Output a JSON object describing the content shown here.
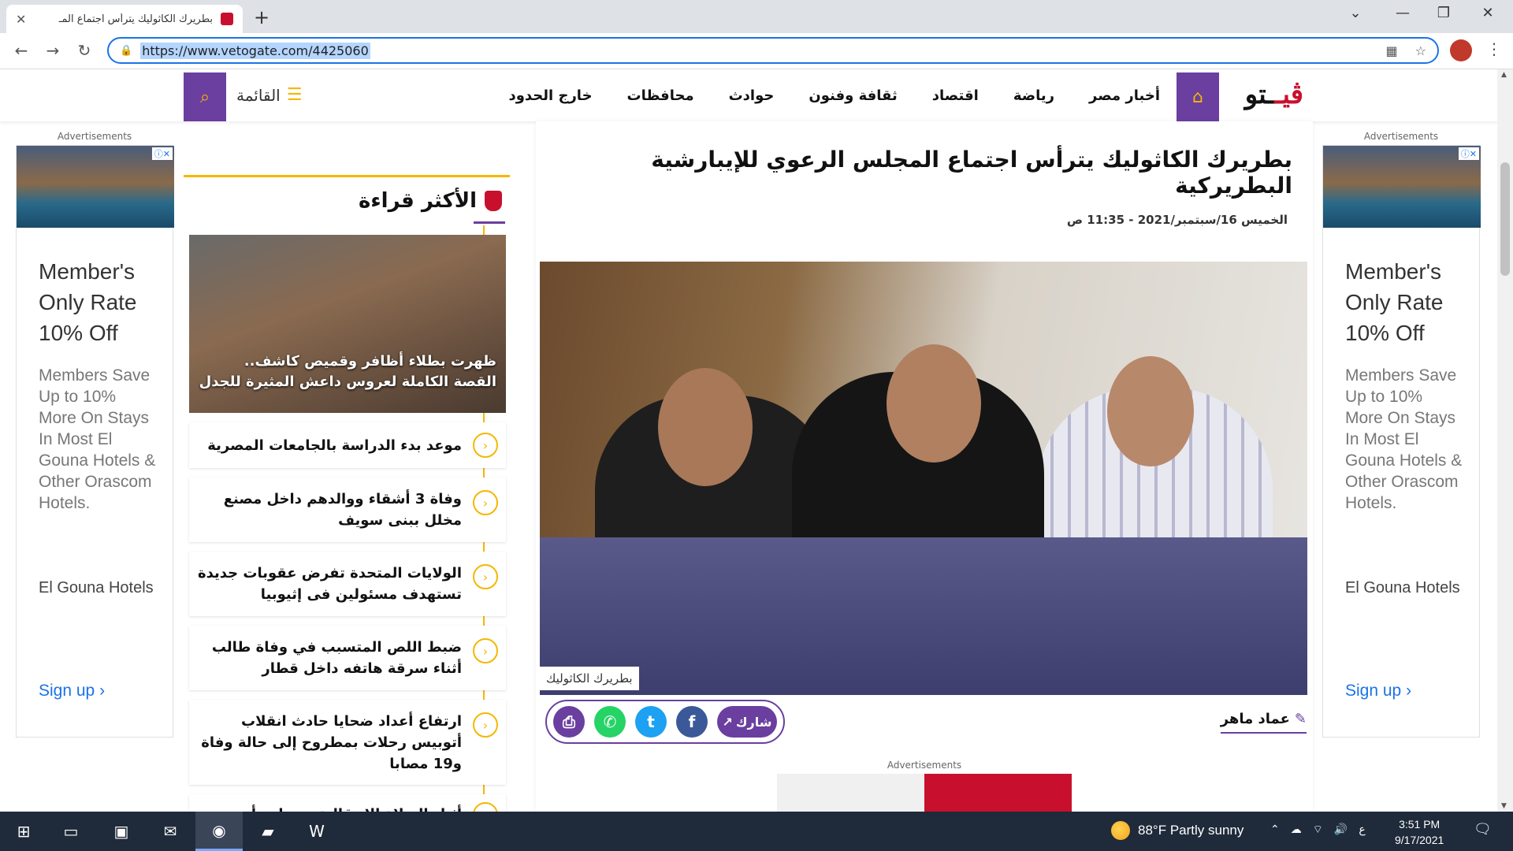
{
  "browser": {
    "tab_title": "بطريرك الكاثوليك يترأس اجتماع المـ",
    "url": "https://www.vetogate.com/4425060",
    "new_tab": "+",
    "close_tab": "✕"
  },
  "site": {
    "logo": {
      "part1": "ڤيـ",
      "part2": "ـتو"
    },
    "nav": [
      "أخبار مصر",
      "رياضة",
      "اقتصاد",
      "ثقافة وفنون",
      "حوادث",
      "محافظات",
      "خارج الحدود"
    ],
    "menu_label": "القائمة"
  },
  "ads": {
    "label": "Advertisements",
    "headline": "Member's Only Rate 10% Off",
    "text": "Members Save Up to 10% More On Stays In Most El Gouna Hotels & Other Orascom Hotels.",
    "brand": "El Gouna Hotels",
    "cta": "Sign up"
  },
  "most_read": {
    "title": "الأكثر قراءة",
    "feature_caption": "ظهرت بطلاء أظافر وقميص كاشف.. القصة الكاملة لعروس داعش المثيرة للجدل",
    "items": [
      "موعد بدء الدراسة بالجامعات المصرية",
      "وفاة 3 أشقاء ووالدهم داخل مصنع مخلل ببنى سويف",
      "الولايات المتحدة تفرض عقوبات جديدة تستهدف مسئولين فى إثيوبيا",
      "ضبط اللص المتسبب في وفاة طالب أثناء سرقة هاتفه داخل قطار",
      "ارتفاع أعداد ضحايا حادث انقلاب أتوبيس رحلات بمطروح إلى حالة وفاة و19 مصابا",
      "أثناء الصلاة الانتقالية... تعليم أو..."
    ]
  },
  "article": {
    "title": "بطريرك الكاثوليك يترأس اجتماع المجلس الرعوي للإيبارشية البطريركية",
    "date": "الخميس 16/سبتمبر/2021 - 11:35 ص",
    "image_caption": "بطريرك الكاثوليك",
    "author": "عماد ماهر",
    "share_label": "شارك",
    "ad_label": "Advertisements"
  },
  "taskbar": {
    "weather": "88°F  Partly sunny",
    "time": "3:51 PM",
    "date": "9/17/2021",
    "lang": "ع"
  },
  "colors": {
    "brand_purple": "#6a3fa0",
    "brand_yellow": "#f5b700",
    "brand_red": "#c8102e"
  }
}
